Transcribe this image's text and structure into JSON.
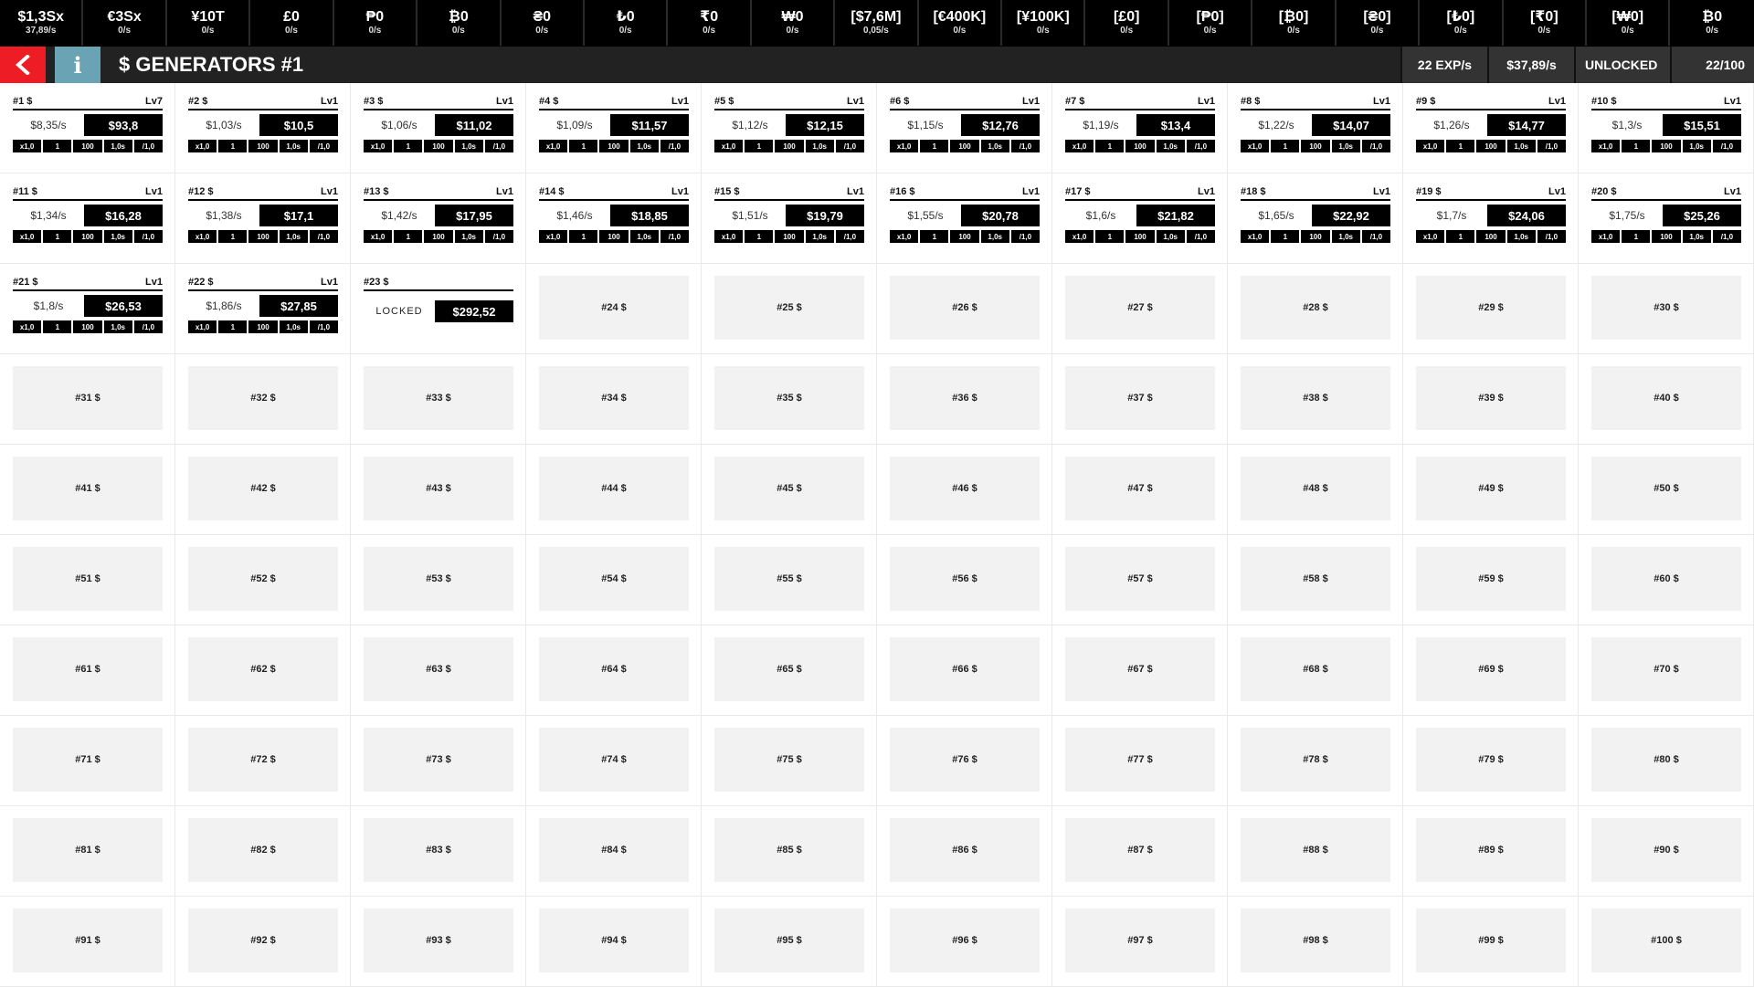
{
  "currencies": [
    {
      "value": "$1,3Sx",
      "rate": "37,89/s"
    },
    {
      "value": "€3Sx",
      "rate": "0/s"
    },
    {
      "value": "¥10T",
      "rate": "0/s"
    },
    {
      "value": "£0",
      "rate": "0/s"
    },
    {
      "value": "₱0",
      "rate": "0/s"
    },
    {
      "value": "₿0",
      "rate": "0/s"
    },
    {
      "value": "₴0",
      "rate": "0/s"
    },
    {
      "value": "₺0",
      "rate": "0/s"
    },
    {
      "value": "₹0",
      "rate": "0/s"
    },
    {
      "value": "₩0",
      "rate": "0/s"
    },
    {
      "value": "[$7,6M]",
      "rate": "0,05/s"
    },
    {
      "value": "[€400K]",
      "rate": "0/s"
    },
    {
      "value": "[¥100K]",
      "rate": "0/s"
    },
    {
      "value": "[£0]",
      "rate": "0/s"
    },
    {
      "value": "[₱0]",
      "rate": "0/s"
    },
    {
      "value": "[₿0]",
      "rate": "0/s"
    },
    {
      "value": "[₴0]",
      "rate": "0/s"
    },
    {
      "value": "[₺0]",
      "rate": "0/s"
    },
    {
      "value": "[₹0]",
      "rate": "0/s"
    },
    {
      "value": "[₩0]",
      "rate": "0/s"
    },
    {
      "value": "₿0",
      "rate": "0/s"
    }
  ],
  "header": {
    "back_icon": "chevron-left-icon",
    "info_label": "i",
    "title": "$ GENERATORS #1",
    "exp": "22 EXP/s",
    "rate": "$37,89/s",
    "status": "UNLOCKED",
    "count": "22/100",
    "accent_red": "#ee1c24",
    "info_blue": "#6aa3b4"
  },
  "buttons": [
    "x1,0",
    "1",
    "100",
    "1,0s",
    "/1,0"
  ],
  "locked_label": "LOCKED",
  "generators": [
    {
      "name": "#1 $",
      "level": "Lv7",
      "rate": "$8,35/s",
      "price": "$93,8"
    },
    {
      "name": "#2 $",
      "level": "Lv1",
      "rate": "$1,03/s",
      "price": "$10,5"
    },
    {
      "name": "#3 $",
      "level": "Lv1",
      "rate": "$1,06/s",
      "price": "$11,02"
    },
    {
      "name": "#4 $",
      "level": "Lv1",
      "rate": "$1,09/s",
      "price": "$11,57"
    },
    {
      "name": "#5 $",
      "level": "Lv1",
      "rate": "$1,12/s",
      "price": "$12,15"
    },
    {
      "name": "#6 $",
      "level": "Lv1",
      "rate": "$1,15/s",
      "price": "$12,76"
    },
    {
      "name": "#7 $",
      "level": "Lv1",
      "rate": "$1,19/s",
      "price": "$13,4"
    },
    {
      "name": "#8 $",
      "level": "Lv1",
      "rate": "$1,22/s",
      "price": "$14,07"
    },
    {
      "name": "#9 $",
      "level": "Lv1",
      "rate": "$1,26/s",
      "price": "$14,77"
    },
    {
      "name": "#10 $",
      "level": "Lv1",
      "rate": "$1,3/s",
      "price": "$15,51"
    },
    {
      "name": "#11 $",
      "level": "Lv1",
      "rate": "$1,34/s",
      "price": "$16,28"
    },
    {
      "name": "#12 $",
      "level": "Lv1",
      "rate": "$1,38/s",
      "price": "$17,1"
    },
    {
      "name": "#13 $",
      "level": "Lv1",
      "rate": "$1,42/s",
      "price": "$17,95"
    },
    {
      "name": "#14 $",
      "level": "Lv1",
      "rate": "$1,46/s",
      "price": "$18,85"
    },
    {
      "name": "#15 $",
      "level": "Lv1",
      "rate": "$1,51/s",
      "price": "$19,79"
    },
    {
      "name": "#16 $",
      "level": "Lv1",
      "rate": "$1,55/s",
      "price": "$20,78"
    },
    {
      "name": "#17 $",
      "level": "Lv1",
      "rate": "$1,6/s",
      "price": "$21,82"
    },
    {
      "name": "#18 $",
      "level": "Lv1",
      "rate": "$1,65/s",
      "price": "$22,92"
    },
    {
      "name": "#19 $",
      "level": "Lv1",
      "rate": "$1,7/s",
      "price": "$24,06"
    },
    {
      "name": "#20 $",
      "level": "Lv1",
      "rate": "$1,75/s",
      "price": "$25,26"
    },
    {
      "name": "#21 $",
      "level": "Lv1",
      "rate": "$1,8/s",
      "price": "$26,53"
    },
    {
      "name": "#22 $",
      "level": "Lv1",
      "rate": "$1,86/s",
      "price": "$27,85"
    }
  ],
  "locked_generator": {
    "name": "#23 $",
    "price": "$292,52"
  },
  "empty_slots": [
    "#24 $",
    "#25 $",
    "#26 $",
    "#27 $",
    "#28 $",
    "#29 $",
    "#30 $",
    "#31 $",
    "#32 $",
    "#33 $",
    "#34 $",
    "#35 $",
    "#36 $",
    "#37 $",
    "#38 $",
    "#39 $",
    "#40 $",
    "#41 $",
    "#42 $",
    "#43 $",
    "#44 $",
    "#45 $",
    "#46 $",
    "#47 $",
    "#48 $",
    "#49 $",
    "#50 $",
    "#51 $",
    "#52 $",
    "#53 $",
    "#54 $",
    "#55 $",
    "#56 $",
    "#57 $",
    "#58 $",
    "#59 $",
    "#60 $",
    "#61 $",
    "#62 $",
    "#63 $",
    "#64 $",
    "#65 $",
    "#66 $",
    "#67 $",
    "#68 $",
    "#69 $",
    "#70 $",
    "#71 $",
    "#72 $",
    "#73 $",
    "#74 $",
    "#75 $",
    "#76 $",
    "#77 $",
    "#78 $",
    "#79 $",
    "#80 $",
    "#81 $",
    "#82 $",
    "#83 $",
    "#84 $",
    "#85 $",
    "#86 $",
    "#87 $",
    "#88 $",
    "#89 $",
    "#90 $",
    "#91 $",
    "#92 $",
    "#93 $",
    "#94 $",
    "#95 $",
    "#96 $",
    "#97 $",
    "#98 $",
    "#99 $",
    "#100 $"
  ]
}
